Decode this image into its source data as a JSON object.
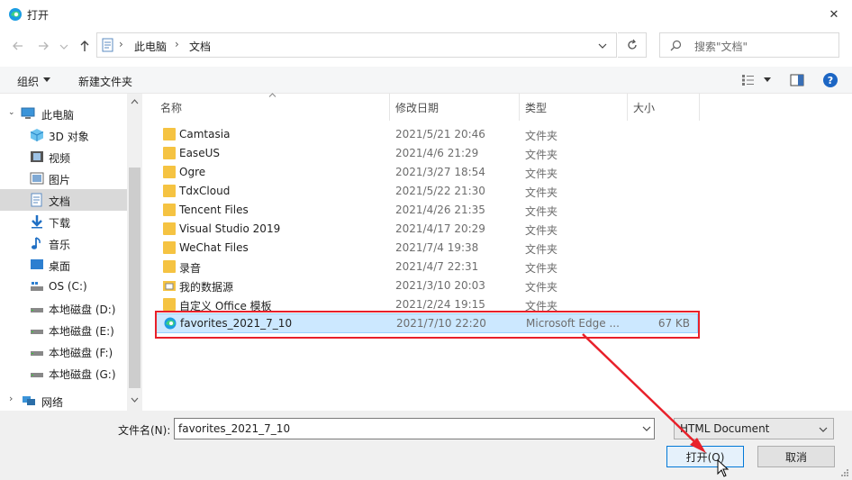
{
  "window": {
    "title": "打开",
    "close_glyph": "✕"
  },
  "address": {
    "crumbs": [
      "此电脑",
      "文档"
    ],
    "separator": "›",
    "dropdown_glyph": "⌵",
    "refresh_glyph": "↻"
  },
  "search": {
    "placeholder": "搜索\"文档\""
  },
  "toolbar": {
    "organize": "组织",
    "new_folder": "新建文件夹",
    "help": "?"
  },
  "nav": {
    "items": [
      {
        "label": "此电脑",
        "icon": "computer-icon"
      },
      {
        "label": "3D 对象",
        "icon": "cube-icon"
      },
      {
        "label": "视频",
        "icon": "video-icon"
      },
      {
        "label": "图片",
        "icon": "picture-icon"
      },
      {
        "label": "文档",
        "icon": "document-icon",
        "selected": true
      },
      {
        "label": "下载",
        "icon": "download-icon"
      },
      {
        "label": "音乐",
        "icon": "music-icon"
      },
      {
        "label": "桌面",
        "icon": "desktop-icon"
      },
      {
        "label": "OS (C:)",
        "icon": "drive-icon"
      },
      {
        "label": "本地磁盘 (D:)",
        "icon": "drive-icon"
      },
      {
        "label": "本地磁盘 (E:)",
        "icon": "drive-icon"
      },
      {
        "label": "本地磁盘 (F:)",
        "icon": "drive-icon"
      },
      {
        "label": "本地磁盘 (G:)",
        "icon": "drive-icon"
      },
      {
        "label": "网络",
        "icon": "network-icon"
      }
    ]
  },
  "columns": {
    "name": "名称",
    "date": "修改日期",
    "type": "类型",
    "size": "大小"
  },
  "files": [
    {
      "name": "Camtasia",
      "date": "2021/5/21 20:46",
      "type": "文件夹",
      "size": "",
      "icon": "folder-icon"
    },
    {
      "name": "EaseUS",
      "date": "2021/4/6 21:29",
      "type": "文件夹",
      "size": "",
      "icon": "folder-icon"
    },
    {
      "name": "Ogre",
      "date": "2021/3/27 18:54",
      "type": "文件夹",
      "size": "",
      "icon": "folder-icon"
    },
    {
      "name": "TdxCloud",
      "date": "2021/5/22 21:30",
      "type": "文件夹",
      "size": "",
      "icon": "folder-icon"
    },
    {
      "name": "Tencent Files",
      "date": "2021/4/26 21:35",
      "type": "文件夹",
      "size": "",
      "icon": "folder-icon"
    },
    {
      "name": "Visual Studio 2019",
      "date": "2021/4/17 20:29",
      "type": "文件夹",
      "size": "",
      "icon": "folder-icon"
    },
    {
      "name": "WeChat Files",
      "date": "2021/7/4 19:38",
      "type": "文件夹",
      "size": "",
      "icon": "folder-icon"
    },
    {
      "name": "录音",
      "date": "2021/4/7 22:31",
      "type": "文件夹",
      "size": "",
      "icon": "folder-icon"
    },
    {
      "name": "我的数据源",
      "date": "2021/3/10 20:03",
      "type": "文件夹",
      "size": "",
      "icon": "data-source-folder-icon"
    },
    {
      "name": "自定义 Office 模板",
      "date": "2021/2/24 19:15",
      "type": "文件夹",
      "size": "",
      "icon": "folder-icon"
    },
    {
      "name": "favorites_2021_7_10",
      "date": "2021/7/10 22:20",
      "type": "Microsoft Edge ...",
      "size": "67 KB",
      "icon": "edge-icon",
      "selected": true
    }
  ],
  "bottom": {
    "filename_label": "文件名(N):",
    "filename_value": "favorites_2021_7_10",
    "filetype_value": "HTML Document",
    "open_label": "打开(O)",
    "cancel_label": "取消"
  },
  "colors": {
    "selection_bg": "#cce8ff",
    "selection_border": "#99d1ff",
    "highlight_red": "#e8202a",
    "folder": "#f5c342",
    "accent": "#0078d7"
  }
}
